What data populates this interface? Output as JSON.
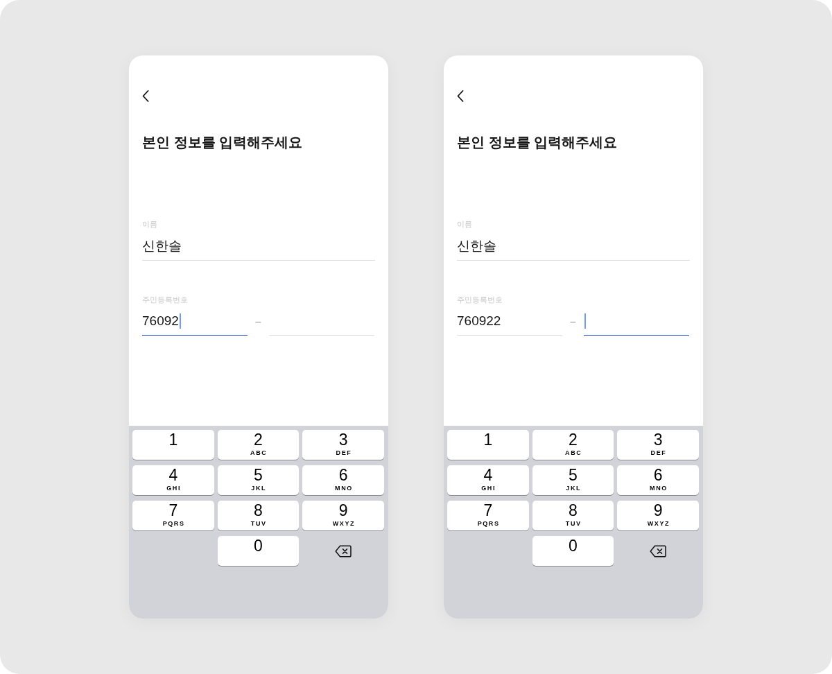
{
  "screens": [
    {
      "title": "본인 정보를 입력해주세요",
      "name_field": {
        "label": "이름",
        "value": "신한솔",
        "focused": false
      },
      "id_field": {
        "label": "주민등록번호",
        "front": {
          "value": "76092",
          "focused": true
        },
        "separator": "–",
        "back": {
          "focused": false
        }
      },
      "keypad": [
        {
          "kind": "digit",
          "digit": "1"
        },
        {
          "kind": "digit",
          "digit": "2",
          "letters": "ABC"
        },
        {
          "kind": "digit",
          "digit": "3",
          "letters": "DEF"
        },
        {
          "kind": "digit",
          "digit": "4",
          "letters": "GHI"
        },
        {
          "kind": "digit",
          "digit": "5",
          "letters": "JKL"
        },
        {
          "kind": "digit",
          "digit": "6",
          "letters": "MNO"
        },
        {
          "kind": "digit",
          "digit": "7",
          "letters": "PQRS"
        },
        {
          "kind": "digit",
          "digit": "8",
          "letters": "TUV"
        },
        {
          "kind": "digit",
          "digit": "9",
          "letters": "WXYZ"
        },
        {
          "kind": "blank"
        },
        {
          "kind": "digit",
          "digit": "0"
        },
        {
          "kind": "delete"
        }
      ]
    },
    {
      "title": "본인 정보를 입력해주세요",
      "name_field": {
        "label": "이름",
        "value": "신한솔",
        "focused": false
      },
      "id_field": {
        "label": "주민등록번호",
        "front": {
          "value": "760922",
          "focused": false
        },
        "separator": "–",
        "back": {
          "focused": true
        }
      },
      "keypad": [
        {
          "kind": "digit",
          "digit": "1"
        },
        {
          "kind": "digit",
          "digit": "2",
          "letters": "ABC"
        },
        {
          "kind": "digit",
          "digit": "3",
          "letters": "DEF"
        },
        {
          "kind": "digit",
          "digit": "4",
          "letters": "GHI"
        },
        {
          "kind": "digit",
          "digit": "5",
          "letters": "JKL"
        },
        {
          "kind": "digit",
          "digit": "6",
          "letters": "MNO"
        },
        {
          "kind": "digit",
          "digit": "7",
          "letters": "PQRS"
        },
        {
          "kind": "digit",
          "digit": "8",
          "letters": "TUV"
        },
        {
          "kind": "digit",
          "digit": "9",
          "letters": "WXYZ"
        },
        {
          "kind": "blank"
        },
        {
          "kind": "digit",
          "digit": "0"
        },
        {
          "kind": "delete"
        }
      ]
    }
  ]
}
